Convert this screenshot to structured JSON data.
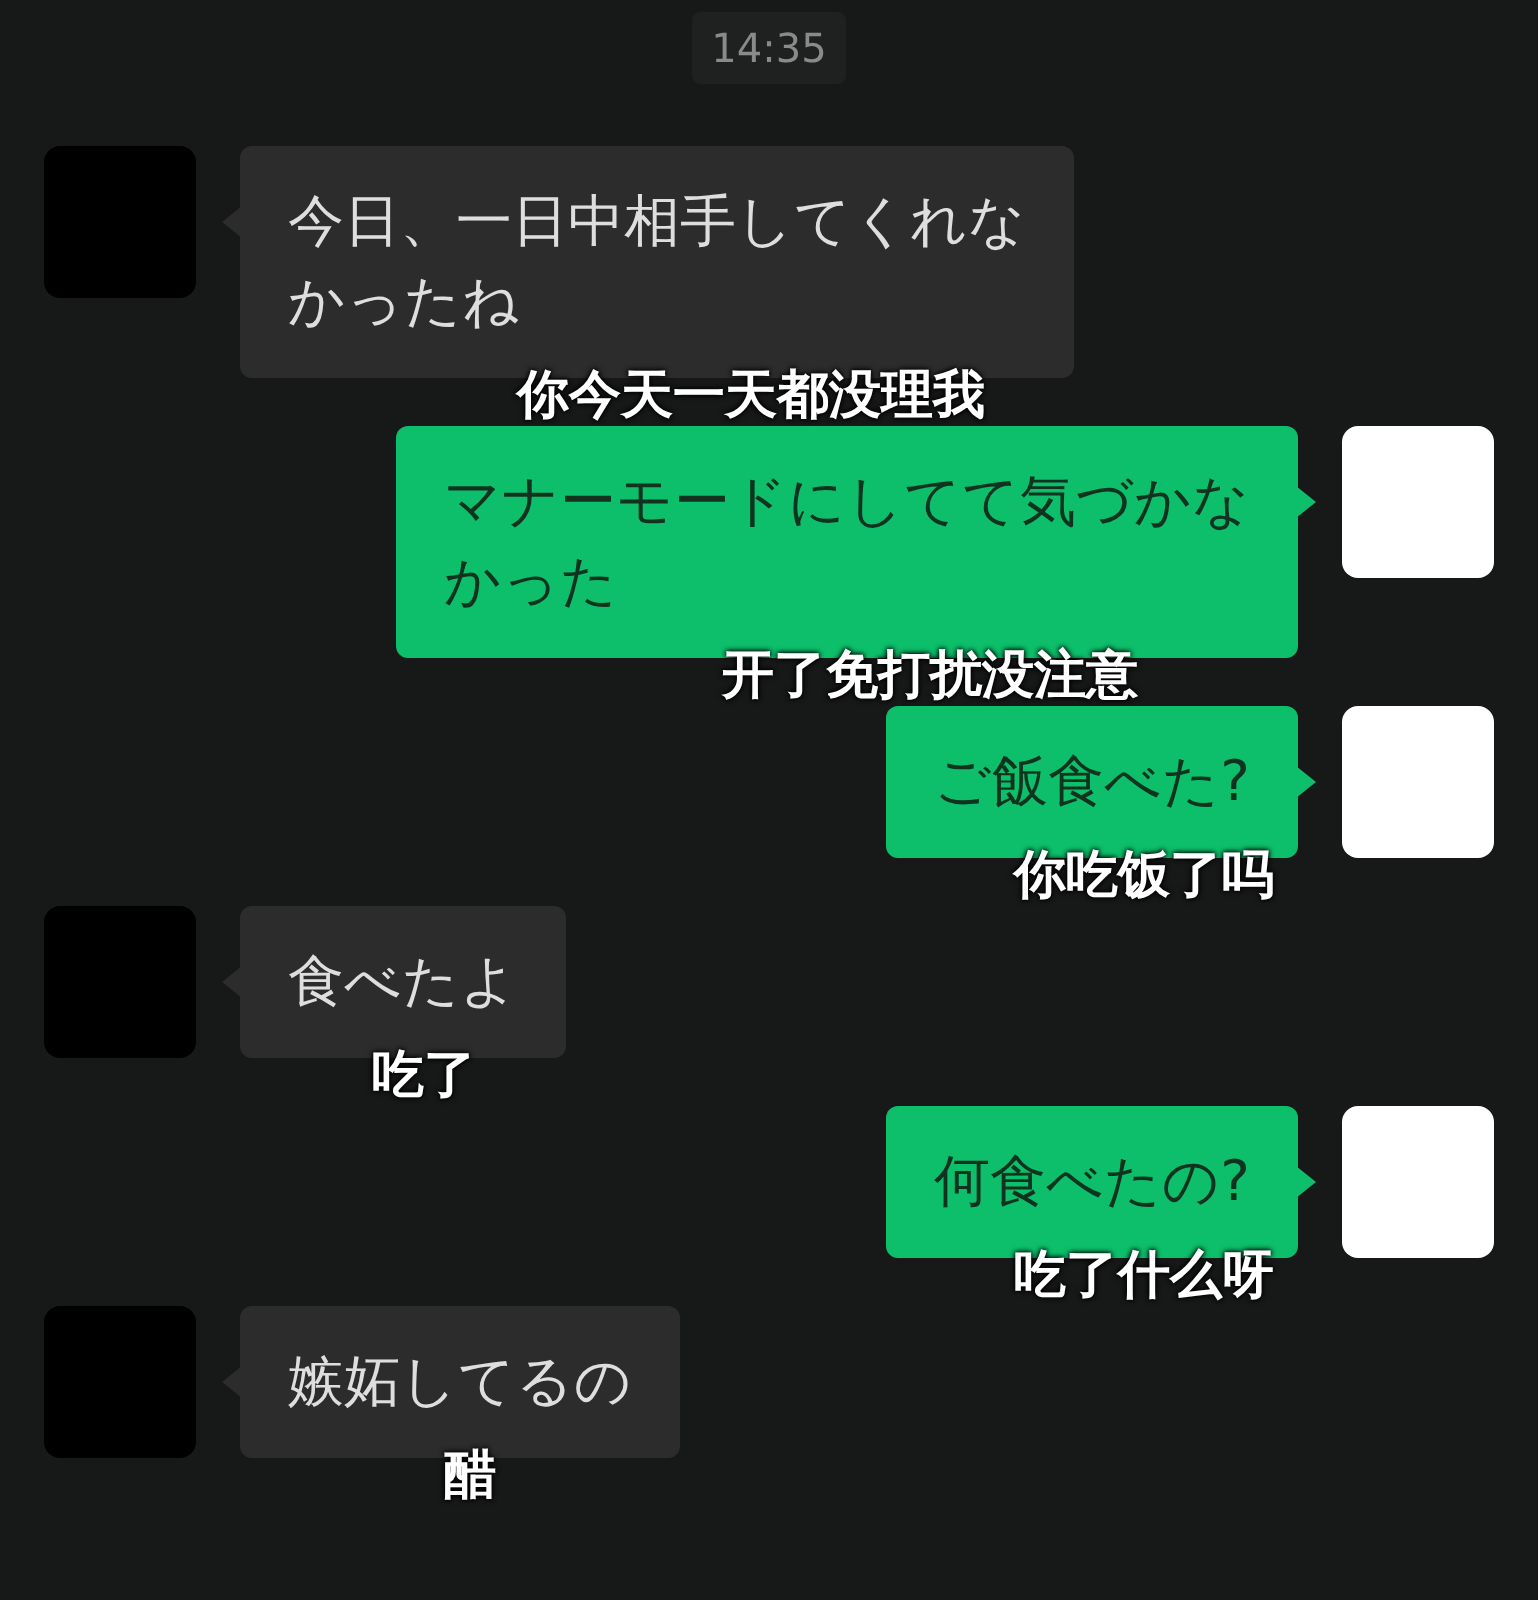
{
  "time": "14:35",
  "messages": [
    {
      "kind": "received",
      "lines": [
        "今日、一日中相手してくれな",
        "かったね"
      ],
      "subtitle": "你今天一天都没理我"
    },
    {
      "kind": "sent",
      "lines": [
        "マナーモードにしてて気づかな",
        "かった"
      ],
      "subtitle": "开了免打扰没注意"
    },
    {
      "kind": "sent",
      "lines": [
        "ご飯食べた?"
      ],
      "subtitle": "你吃饭了吗"
    },
    {
      "kind": "received",
      "lines": [
        "食べたよ"
      ],
      "subtitle": "吃了"
    },
    {
      "kind": "sent",
      "lines": [
        "何食べたの?"
      ],
      "subtitle": "吃了什么呀"
    },
    {
      "kind": "received",
      "lines": [
        "嫉妬してるの"
      ],
      "subtitle": "醋"
    }
  ]
}
